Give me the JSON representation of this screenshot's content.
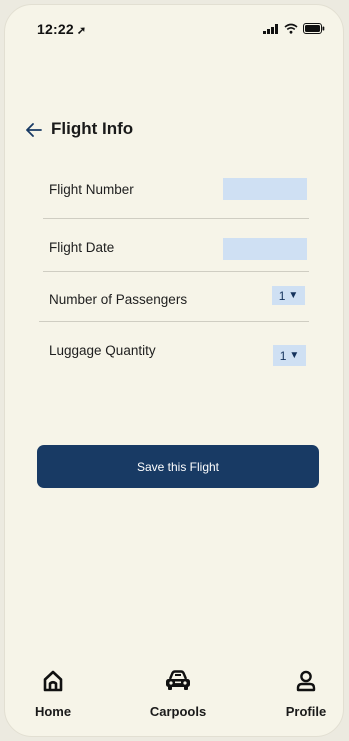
{
  "status_bar": {
    "time": "12:22",
    "location_glyph": "➚"
  },
  "header": {
    "back_icon": "arrow-left-icon",
    "title": "Flight Info"
  },
  "form": {
    "flight_number": {
      "label": "Flight Number",
      "value": ""
    },
    "flight_date": {
      "label": "Flight Date",
      "value": ""
    },
    "passengers": {
      "label": "Number of Passengers",
      "value": "1",
      "caret": "▼"
    },
    "luggage": {
      "label": "Luggage Quantity",
      "value": "1",
      "caret": "▼"
    }
  },
  "save_button": {
    "label": "Save this Flight"
  },
  "nav": {
    "home": {
      "label": "Home",
      "icon": "home-icon"
    },
    "carpools": {
      "label": "Carpools",
      "icon": "car-icon"
    },
    "profile": {
      "label": "Profile",
      "icon": "user-icon"
    }
  },
  "colors": {
    "background": "#f6f4e8",
    "primary": "#183a64",
    "input_fill": "#cfe0f3"
  }
}
